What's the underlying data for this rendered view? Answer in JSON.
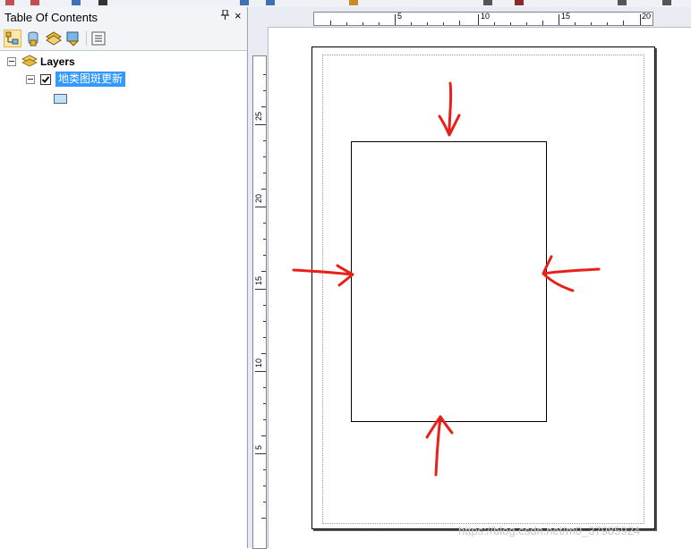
{
  "toc": {
    "title": "Table Of Contents",
    "pin_glyph": "ᵻ",
    "close_glyph": "×",
    "tools": [
      "list-by-drawing-order-icon",
      "list-by-source-icon",
      "list-by-visibility-icon",
      "list-by-selection-icon",
      "options-icon"
    ],
    "tree": {
      "root_label": "Layers",
      "layer_name": "地类图斑更新",
      "layer_checked": true
    }
  },
  "layout": {
    "ruler_h_labels": [
      "5",
      "10",
      "15",
      "20"
    ],
    "ruler_v_labels": [
      "25",
      "20",
      "15",
      "10",
      "5"
    ]
  },
  "annotations": {
    "arrow_color": "#e8201a",
    "arrows": [
      "down-arrow-top",
      "right-arrow-left",
      "left-arrow-right",
      "up-arrow-bottom"
    ]
  },
  "watermark": "https://blog.csdn.net/m0_37985924",
  "colors": {
    "selection": "#3399ff",
    "panel": "#f2f4f8",
    "ruler": "#e8ecf2"
  }
}
